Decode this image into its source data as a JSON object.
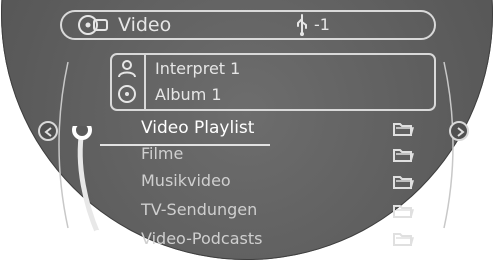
{
  "header": {
    "title": "Video",
    "source_label": "-1"
  },
  "info": {
    "artist": "Interpret 1",
    "album": "Album 1"
  },
  "menu": {
    "items": [
      {
        "label": "Video Playlist"
      },
      {
        "label": "Filme"
      },
      {
        "label": "Musikvideo"
      },
      {
        "label": "TV-Sendungen"
      },
      {
        "label": "Video-Podcasts"
      }
    ],
    "selected_index": 0
  },
  "colors": {
    "background": "#5a5a5a",
    "text": "#e6e6e6",
    "outline": "#d9d9d9"
  },
  "icons": [
    "video-icon",
    "usb-icon",
    "person-icon",
    "disc-icon",
    "chevron-left-icon",
    "chevron-right-icon",
    "folder-icon"
  ]
}
